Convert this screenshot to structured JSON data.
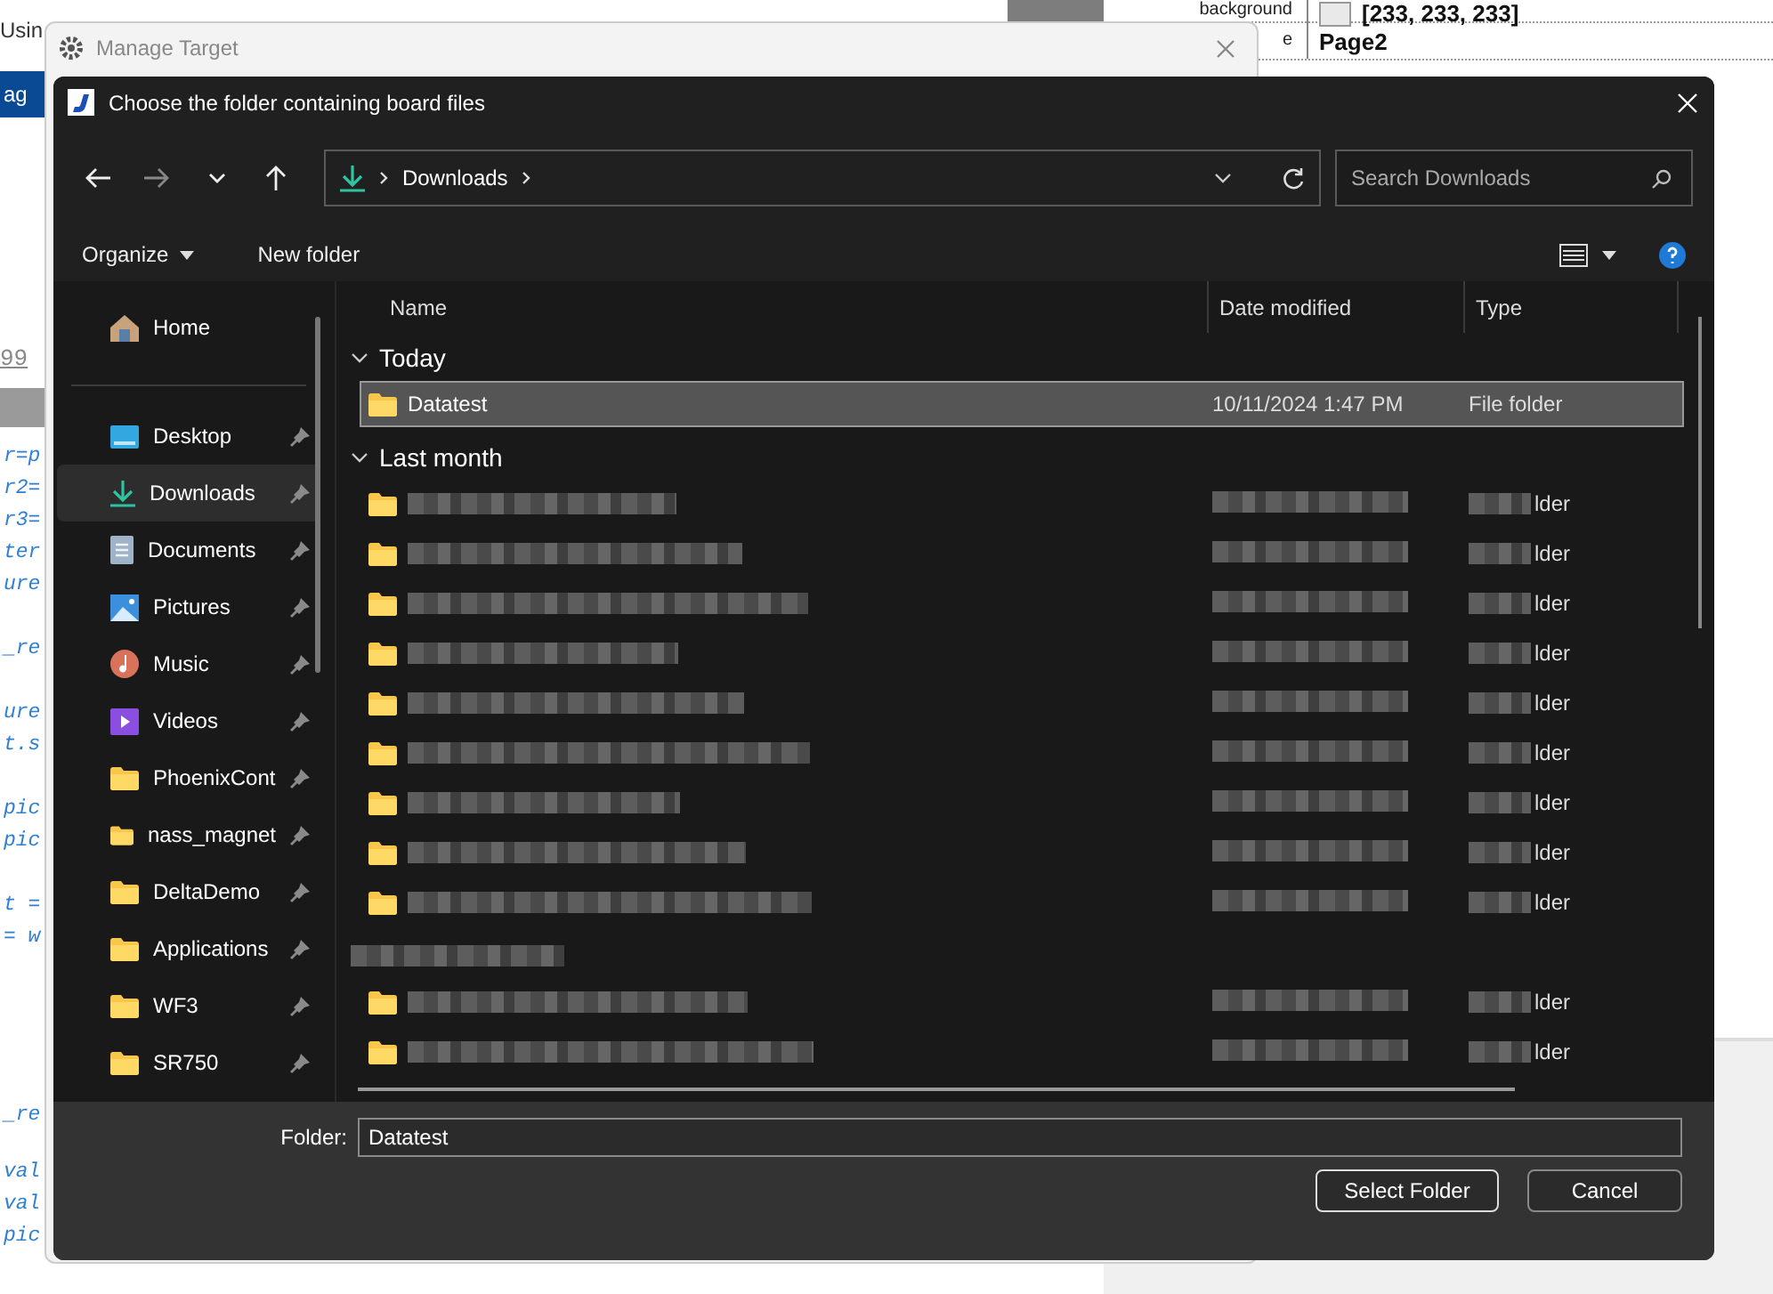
{
  "background_app": {
    "title_fragment": "Usin",
    "tab_fragment": "ag",
    "number_fragment": "99",
    "code_blocks": [
      [
        "r=p",
        "r2=",
        "r3=",
        "ter",
        "ure"
      ],
      [
        "_re"
      ],
      [
        "ure",
        "t.s"
      ],
      [
        "pic",
        "pic"
      ],
      [
        "t =",
        "= w"
      ]
    ],
    "code_blocks_lower": [
      [
        "_re"
      ],
      [
        "val",
        "val",
        "pic"
      ]
    ],
    "properties": [
      {
        "name": "background",
        "value": "[233, 233, 233]"
      },
      {
        "name": "e",
        "value": "Page2"
      }
    ]
  },
  "manage_window": {
    "title": "Manage Target"
  },
  "dialog": {
    "title": "Choose the folder containing board files",
    "address": {
      "location": "Downloads"
    },
    "search": {
      "placeholder": "Search Downloads"
    },
    "commands": [
      {
        "label": "Organize",
        "dropdown": true
      },
      {
        "label": "New folder",
        "dropdown": false
      }
    ],
    "sidebar": [
      {
        "label": "Home",
        "kind": "home",
        "pinned": false,
        "selected": false
      },
      {
        "label": "Desktop",
        "kind": "desktop",
        "pinned": true,
        "selected": false
      },
      {
        "label": "Downloads",
        "kind": "downloads",
        "pinned": true,
        "selected": true
      },
      {
        "label": "Documents",
        "kind": "documents",
        "pinned": true,
        "selected": false
      },
      {
        "label": "Pictures",
        "kind": "pictures",
        "pinned": true,
        "selected": false
      },
      {
        "label": "Music",
        "kind": "music",
        "pinned": true,
        "selected": false
      },
      {
        "label": "Videos",
        "kind": "videos",
        "pinned": true,
        "selected": false
      },
      {
        "label": "PhoenixCont",
        "kind": "folder",
        "pinned": true,
        "selected": false
      },
      {
        "label": "nass_magnet",
        "kind": "folder",
        "pinned": true,
        "selected": false
      },
      {
        "label": "DeltaDemo",
        "kind": "folder",
        "pinned": true,
        "selected": false
      },
      {
        "label": "Applications",
        "kind": "folder",
        "pinned": true,
        "selected": false
      },
      {
        "label": "WF3",
        "kind": "folder",
        "pinned": true,
        "selected": false
      },
      {
        "label": "SR750",
        "kind": "folder",
        "pinned": true,
        "selected": false
      }
    ],
    "columns": [
      "Name",
      "Date modified",
      "Type"
    ],
    "entries": [
      {
        "kind": "group",
        "label": "Today"
      },
      {
        "kind": "folder",
        "name": "Datatest",
        "date": "10/11/2024 1:47 PM",
        "type": "File folder",
        "selected": true
      },
      {
        "kind": "group",
        "label": "Last month"
      },
      {
        "kind": "blurred",
        "type_tail": "lder"
      },
      {
        "kind": "blurred",
        "type_tail": "lder"
      },
      {
        "kind": "blurred",
        "type_tail": "lder"
      },
      {
        "kind": "blurred",
        "type_tail": "lder"
      },
      {
        "kind": "blurred",
        "type_tail": "lder"
      },
      {
        "kind": "blurred",
        "type_tail": "lder"
      },
      {
        "kind": "blurred",
        "type_tail": "lder"
      },
      {
        "kind": "blurred",
        "type_tail": "lder"
      },
      {
        "kind": "blurred",
        "type_tail": "lder"
      },
      {
        "kind": "blurred-group"
      },
      {
        "kind": "blurred",
        "type_tail": "lder"
      },
      {
        "kind": "blurred",
        "type_tail": "lder"
      }
    ],
    "folder_field": {
      "label": "Folder:",
      "value": "Datatest"
    },
    "buttons": [
      {
        "label": "Select Folder",
        "default": true
      },
      {
        "label": "Cancel",
        "default": false
      }
    ]
  }
}
